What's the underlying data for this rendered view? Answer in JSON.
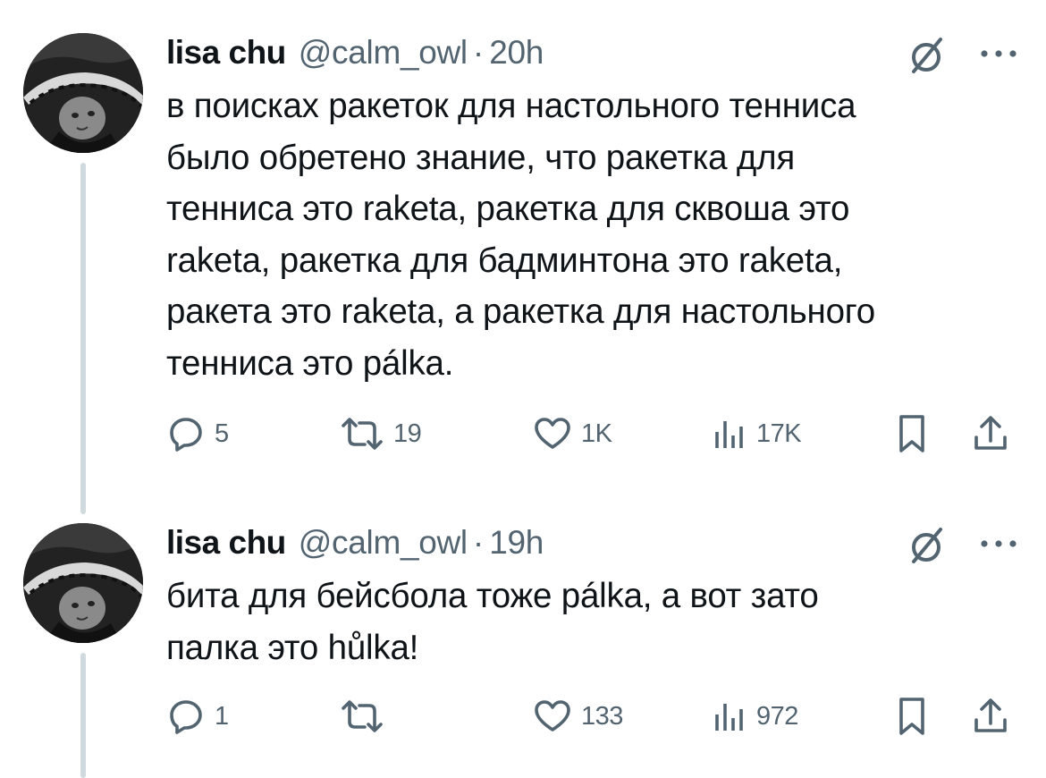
{
  "tweets": [
    {
      "author": {
        "name": "lisa chu",
        "handle": "@calm_owl",
        "separator": "·",
        "time": "20h"
      },
      "text": "в поисках ракеток для настольного тенниса\nбыло обретено знание, что ракетка для\nтенниса это raketa, ракетка для сквоша это\nraketa, ракетка для бадминтона это raketa,\nракета это raketa, а ракетка для настольного\nтенниса это pálka.",
      "stats": {
        "replies": "5",
        "reposts": "19",
        "likes": "1K",
        "views": "17K"
      }
    },
    {
      "author": {
        "name": "lisa chu",
        "handle": "@calm_owl",
        "separator": "·",
        "time": "19h"
      },
      "text": "бита для бейсбола тоже pálka, а вот зато\nпалка это hůlka!",
      "stats": {
        "replies": "1",
        "reposts": "",
        "likes": "133",
        "views": "972"
      }
    }
  ],
  "icons": {
    "reply": "reply-icon",
    "repost": "repost-icon",
    "like": "heart-icon",
    "views": "views-chart-icon",
    "bookmark": "bookmark-icon",
    "share": "share-icon",
    "grok": "grok-icon",
    "more": "more-dots-icon"
  },
  "colors": {
    "text": "#0f1419",
    "secondary": "#536471",
    "thread_line": "#cfd9de",
    "background": "#ffffff"
  }
}
